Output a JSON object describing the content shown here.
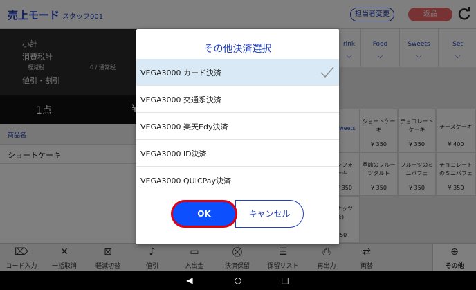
{
  "header": {
    "title": "売上モード",
    "staff": "スタッフ001",
    "staff_change": "担当者変更",
    "return": "返品"
  },
  "summary": {
    "subtotal": "小計",
    "tax": "消費税計",
    "reduced": "軽減税",
    "normal": "0 / 通常税",
    "discount": "値引・割引",
    "count": "1点",
    "yen": "¥"
  },
  "cart": {
    "column_header": "商品名",
    "items": [
      "ショートケーキ"
    ]
  },
  "catalog": {
    "tabs": [
      "rink",
      "Food",
      "Sweets",
      "Set"
    ],
    "sweets_tag": "weets",
    "products": [
      {
        "name": "ショートケー\nキ",
        "price": "¥ 350"
      },
      {
        "name": "チョコレート\nケーキ",
        "price": "¥ 350"
      },
      {
        "name": "チーズケーキ",
        "price": "¥ 400"
      },
      {
        "name": "シフォ\nーキ",
        "price": "¥ 350"
      },
      {
        "name": "季節のフルー\nツタルト",
        "price": "¥ 350"
      },
      {
        "name": "フルーツのミ\nニパフェ",
        "price": "¥ 350"
      },
      {
        "name": "チョコレート\nのミニパフェ",
        "price": "¥ 350"
      },
      {
        "name": "ナッツ\n茶)",
        "price": "250"
      }
    ]
  },
  "toolbar": {
    "items": [
      "コード入力",
      "一括取消",
      "軽減切替",
      "値引",
      "入出金",
      "決済保留",
      "保留リスト",
      "再出力",
      "両替",
      "その他"
    ]
  },
  "modal": {
    "title": "その他決済選択",
    "options": [
      "VEGA3000 カード決済",
      "VEGA3000 交通系決済",
      "VEGA3000 楽天Edy決済",
      "VEGA3000 iD決済",
      "VEGA3000 QUICPay決済"
    ],
    "selected_index": 0,
    "ok": "OK",
    "cancel": "キャンセル"
  },
  "colors": {
    "accent": "#1f3fbf",
    "ok_button": "#0b4fff",
    "ok_border": "#e0000f",
    "return_button": "#ee6666",
    "selected_row": "#d9eaf6"
  }
}
